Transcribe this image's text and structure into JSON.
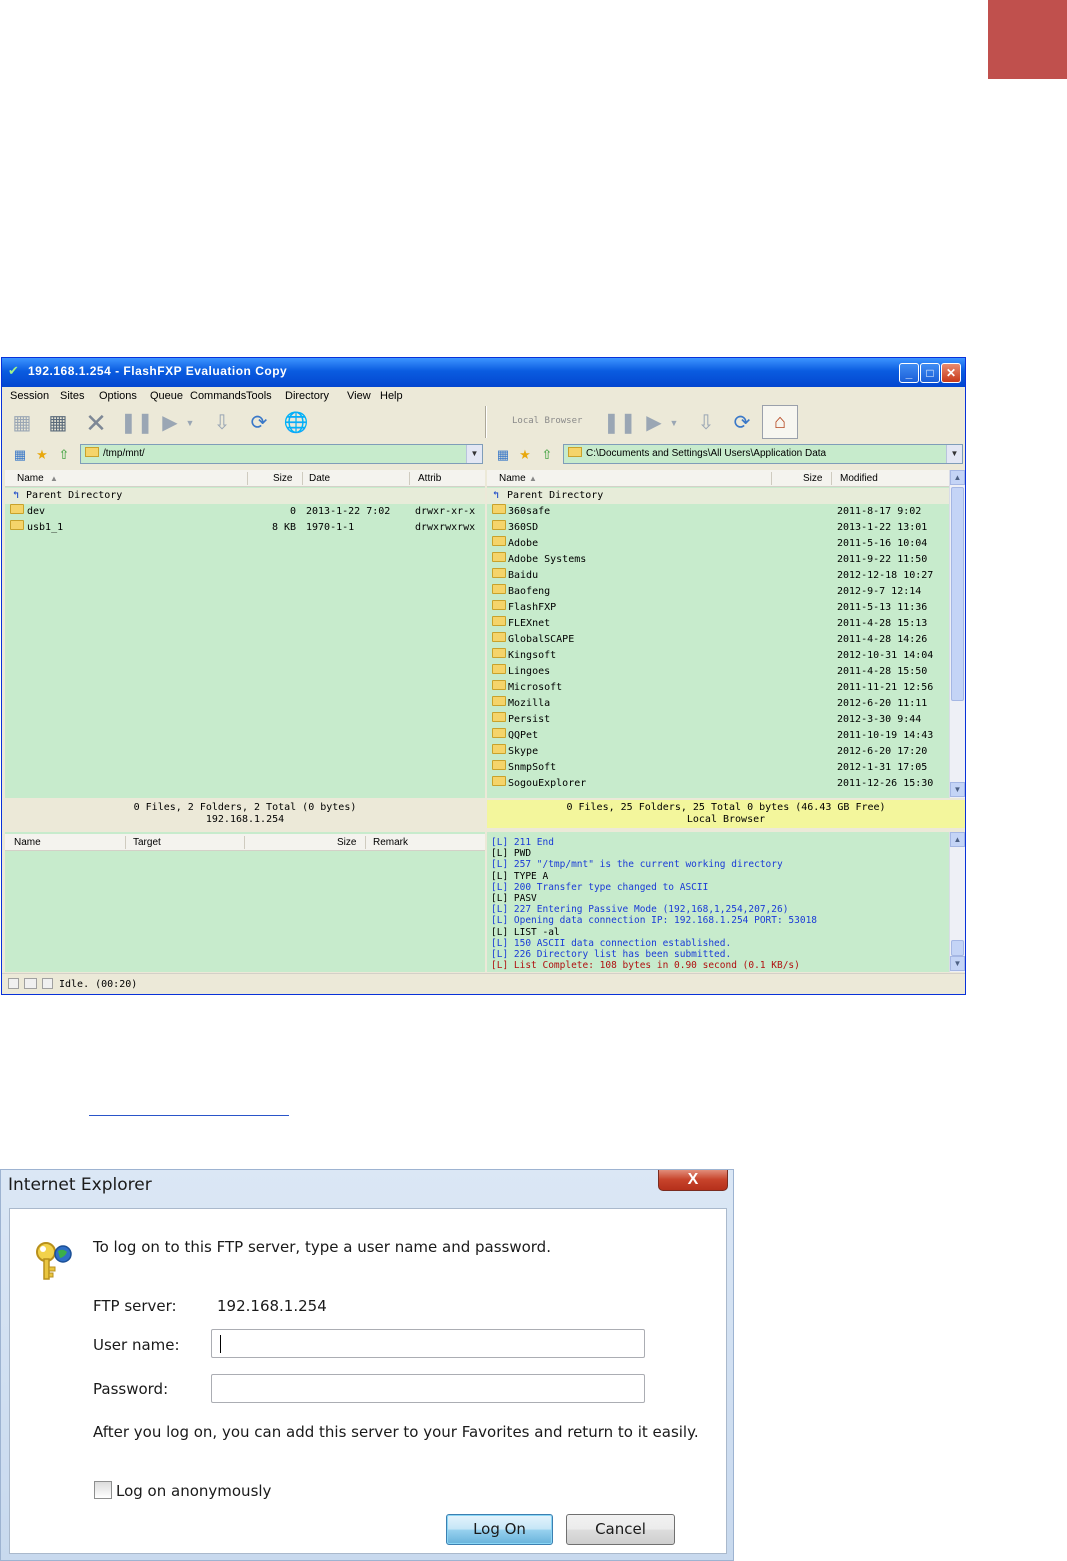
{
  "page": {
    "accent_color": "#c0504d"
  },
  "flashfxp": {
    "title": "192.168.1.254 - FlashFXP Evaluation Copy",
    "menu": [
      "Session",
      "Sites",
      "Options",
      "Queue",
      "Commands",
      "Tools",
      "Directory",
      "View",
      "Help"
    ],
    "right_toolbar_label": "Local Browser",
    "left": {
      "path": "/tmp/mnt/",
      "columns": {
        "name": "Name",
        "size": "Size",
        "date": "Date",
        "attrib": "Attrib"
      },
      "parent": "Parent Directory",
      "rows": [
        {
          "name": "dev",
          "size": "0",
          "date": "2013-1-22 7:02",
          "attrib": "drwxr-xr-x"
        },
        {
          "name": "usb1_1",
          "size": "8 KB",
          "date": "1970-1-1",
          "attrib": "drwxrwxrwx"
        }
      ],
      "status_line1": "0 Files, 2 Folders, 2 Total (0 bytes)",
      "status_line2": "192.168.1.254"
    },
    "right": {
      "path": "C:\\Documents and Settings\\All Users\\Application Data",
      "columns": {
        "name": "Name",
        "size": "Size",
        "modified": "Modified"
      },
      "parent": "Parent Directory",
      "rows": [
        {
          "name": "360safe",
          "modified": "2011-8-17 9:02"
        },
        {
          "name": "360SD",
          "modified": "2013-1-22 13:01"
        },
        {
          "name": "Adobe",
          "modified": "2011-5-16 10:04"
        },
        {
          "name": "Adobe Systems",
          "modified": "2011-9-22 11:50"
        },
        {
          "name": "Baidu",
          "modified": "2012-12-18 10:27"
        },
        {
          "name": "Baofeng",
          "modified": "2012-9-7 12:14"
        },
        {
          "name": "FlashFXP",
          "modified": "2011-5-13 11:36"
        },
        {
          "name": "FLEXnet",
          "modified": "2011-4-28 15:13"
        },
        {
          "name": "GlobalSCAPE",
          "modified": "2011-4-28 14:26"
        },
        {
          "name": "Kingsoft",
          "modified": "2012-10-31 14:04"
        },
        {
          "name": "Lingoes",
          "modified": "2011-4-28 15:50"
        },
        {
          "name": "Microsoft",
          "modified": "2011-11-21 12:56"
        },
        {
          "name": "Mozilla",
          "modified": "2012-6-20 11:11"
        },
        {
          "name": "Persist",
          "modified": "2012-3-30 9:44"
        },
        {
          "name": "QQPet",
          "modified": "2011-10-19 14:43"
        },
        {
          "name": "Skype",
          "modified": "2012-6-20 17:20"
        },
        {
          "name": "SnmpSoft",
          "modified": "2012-1-31 17:05"
        },
        {
          "name": "SogouExplorer",
          "modified": "2011-12-26 15:30"
        }
      ],
      "status_line1": "0 Files, 25 Folders, 25 Total 0 bytes (46.43 GB Free)",
      "status_line2": "Local Browser"
    },
    "queue": {
      "columns": {
        "name": "Name",
        "target": "Target",
        "size": "Size",
        "remark": "Remark"
      }
    },
    "log": [
      {
        "text": "[L] 211 End",
        "color": "#1a3bd6"
      },
      {
        "text": "[L] PWD",
        "color": "#000000"
      },
      {
        "text": "[L] 257 \"/tmp/mnt\" is the current working directory",
        "color": "#1a3bd6"
      },
      {
        "text": "[L] TYPE A",
        "color": "#000000"
      },
      {
        "text": "[L] 200 Transfer type changed to ASCII",
        "color": "#1a3bd6"
      },
      {
        "text": "[L] PASV",
        "color": "#000000"
      },
      {
        "text": "[L] 227 Entering Passive Mode (192,168,1,254,207,26)",
        "color": "#1a3bd6"
      },
      {
        "text": "[L] Opening data connection IP: 192.168.1.254 PORT: 53018",
        "color": "#1a3bd6"
      },
      {
        "text": "[L] LIST -al",
        "color": "#000000"
      },
      {
        "text": "[L] 150 ASCII data connection established.",
        "color": "#1a3bd6"
      },
      {
        "text": "[L] 226 Directory list has been submitted.",
        "color": "#1a3bd6"
      },
      {
        "text": "[L] List Complete: 108 bytes in 0.90 second (0.1 KB/s)",
        "color": "#b01010"
      }
    ],
    "statusbar": "Idle. (00:20)"
  },
  "ie_dialog": {
    "title": "Internet Explorer",
    "close_glyph": "X",
    "intro": "To log on to this FTP server, type a user name and password.",
    "ftp_server_label": "FTP server:",
    "ftp_server_value": "192.168.1.254",
    "username_label": "User name:",
    "username_value": "",
    "password_label": "Password:",
    "password_value": "",
    "info": "After you log on, you can add this server to your Favorites and return to it easily.",
    "anonymous_label": "Log on anonymously",
    "logon_button": "Log On",
    "cancel_button": "Cancel"
  }
}
